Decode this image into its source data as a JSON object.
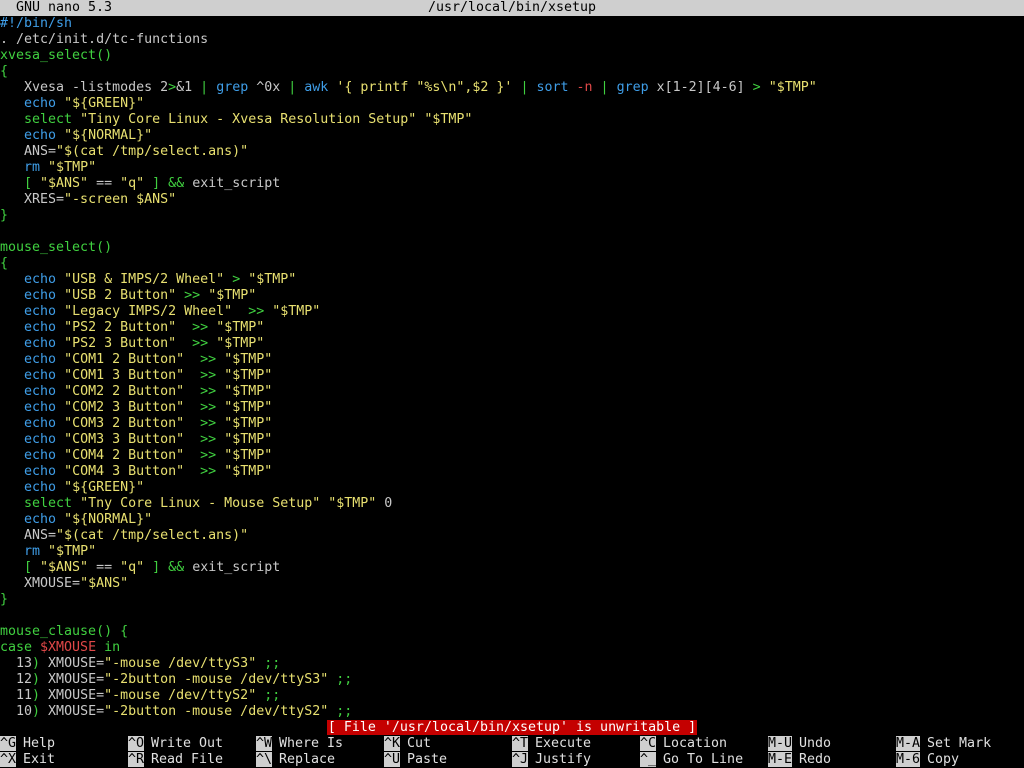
{
  "colors": {
    "default": "#c8c8c8",
    "green": "#40d040",
    "cyan": "#3f9ee8",
    "yellow": "#e8e070",
    "red": "#e04848",
    "white": "#ffffff",
    "status_bg": "#c40000",
    "bar_bg": "#cfcfcf"
  },
  "titlebar": {
    "app": "GNU nano 5.3",
    "file": "/usr/local/bin/xsetup"
  },
  "status": "[ File '/usr/local/bin/xsetup' is unwritable ]",
  "lines": [
    [
      [
        "#!/bin/sh",
        "cyan"
      ]
    ],
    [
      [
        ". /etc/init.d/tc-functions",
        "default"
      ]
    ],
    [
      [
        "xvesa_select()",
        "green"
      ]
    ],
    [
      [
        "{",
        "green"
      ]
    ],
    [
      [
        "   Xvesa -listmodes 2",
        "default"
      ],
      [
        ">",
        "green"
      ],
      [
        "&1 ",
        "default"
      ],
      [
        "|",
        "green"
      ],
      [
        " grep ",
        "cyan"
      ],
      [
        "^0x ",
        "default"
      ],
      [
        "|",
        "green"
      ],
      [
        " awk ",
        "cyan"
      ],
      [
        "'{ printf \"%s\\n\",$2 }'",
        "yellow"
      ],
      [
        " | ",
        "green"
      ],
      [
        "sort",
        "cyan"
      ],
      [
        " -n",
        "red"
      ],
      [
        " | ",
        "green"
      ],
      [
        "grep ",
        "cyan"
      ],
      [
        "x[1-2][4-6] ",
        "default"
      ],
      [
        "> ",
        "green"
      ],
      [
        "\"$TMP\"",
        "yellow"
      ]
    ],
    [
      [
        "   ",
        "default"
      ],
      [
        "echo",
        "cyan"
      ],
      [
        " \"${GREEN}\"",
        "yellow"
      ]
    ],
    [
      [
        "   ",
        "default"
      ],
      [
        "select",
        "green"
      ],
      [
        " \"Tiny Core Linux - Xvesa Resolution Setup\" \"$TMP\"",
        "yellow"
      ]
    ],
    [
      [
        "   ",
        "default"
      ],
      [
        "echo",
        "cyan"
      ],
      [
        " \"${NORMAL}\"",
        "yellow"
      ]
    ],
    [
      [
        "   ANS=",
        "default"
      ],
      [
        "\"$(cat /tmp/select.ans)\"",
        "yellow"
      ]
    ],
    [
      [
        "   ",
        "default"
      ],
      [
        "rm",
        "cyan"
      ],
      [
        " \"$TMP\"",
        "yellow"
      ]
    ],
    [
      [
        "   [ ",
        "green"
      ],
      [
        "\"$ANS\"",
        "yellow"
      ],
      [
        " == ",
        "default"
      ],
      [
        "\"q\"",
        "yellow"
      ],
      [
        " ] && ",
        "green"
      ],
      [
        "exit_script",
        "default"
      ]
    ],
    [
      [
        "   XRES=",
        "default"
      ],
      [
        "\"-screen $ANS\"",
        "yellow"
      ]
    ],
    [
      [
        "}",
        "green"
      ]
    ],
    [
      [
        "",
        "default"
      ]
    ],
    [
      [
        "mouse_select()",
        "green"
      ]
    ],
    [
      [
        "{",
        "green"
      ]
    ],
    [
      [
        "   ",
        "default"
      ],
      [
        "echo",
        "cyan"
      ],
      [
        " \"USB & IMPS/2 Wheel\"",
        "yellow"
      ],
      [
        " > ",
        "green"
      ],
      [
        "\"$TMP\"",
        "yellow"
      ]
    ],
    [
      [
        "   ",
        "default"
      ],
      [
        "echo",
        "cyan"
      ],
      [
        " \"USB 2 Button\"",
        "yellow"
      ],
      [
        " >> ",
        "green"
      ],
      [
        "\"$TMP\"",
        "yellow"
      ]
    ],
    [
      [
        "   ",
        "default"
      ],
      [
        "echo",
        "cyan"
      ],
      [
        " \"Legacy IMPS/2 Wheel\"",
        "yellow"
      ],
      [
        "  >> ",
        "green"
      ],
      [
        "\"$TMP\"",
        "yellow"
      ]
    ],
    [
      [
        "   ",
        "default"
      ],
      [
        "echo",
        "cyan"
      ],
      [
        " \"PS2 2 Button\"",
        "yellow"
      ],
      [
        "  >> ",
        "green"
      ],
      [
        "\"$TMP\"",
        "yellow"
      ]
    ],
    [
      [
        "   ",
        "default"
      ],
      [
        "echo",
        "cyan"
      ],
      [
        " \"PS2 3 Button\"",
        "yellow"
      ],
      [
        "  >> ",
        "green"
      ],
      [
        "\"$TMP\"",
        "yellow"
      ]
    ],
    [
      [
        "   ",
        "default"
      ],
      [
        "echo",
        "cyan"
      ],
      [
        " \"COM1 2 Button\"",
        "yellow"
      ],
      [
        "  >> ",
        "green"
      ],
      [
        "\"$TMP\"",
        "yellow"
      ]
    ],
    [
      [
        "   ",
        "default"
      ],
      [
        "echo",
        "cyan"
      ],
      [
        " \"COM1 3 Button\"",
        "yellow"
      ],
      [
        "  >> ",
        "green"
      ],
      [
        "\"$TMP\"",
        "yellow"
      ]
    ],
    [
      [
        "   ",
        "default"
      ],
      [
        "echo",
        "cyan"
      ],
      [
        " \"COM2 2 Button\"",
        "yellow"
      ],
      [
        "  >> ",
        "green"
      ],
      [
        "\"$TMP\"",
        "yellow"
      ]
    ],
    [
      [
        "   ",
        "default"
      ],
      [
        "echo",
        "cyan"
      ],
      [
        " \"COM2 3 Button\"",
        "yellow"
      ],
      [
        "  >> ",
        "green"
      ],
      [
        "\"$TMP\"",
        "yellow"
      ]
    ],
    [
      [
        "   ",
        "default"
      ],
      [
        "echo",
        "cyan"
      ],
      [
        " \"COM3 2 Button\"",
        "yellow"
      ],
      [
        "  >> ",
        "green"
      ],
      [
        "\"$TMP\"",
        "yellow"
      ]
    ],
    [
      [
        "   ",
        "default"
      ],
      [
        "echo",
        "cyan"
      ],
      [
        " \"COM3 3 Button\"",
        "yellow"
      ],
      [
        "  >> ",
        "green"
      ],
      [
        "\"$TMP\"",
        "yellow"
      ]
    ],
    [
      [
        "   ",
        "default"
      ],
      [
        "echo",
        "cyan"
      ],
      [
        " \"COM4 2 Button\"",
        "yellow"
      ],
      [
        "  >> ",
        "green"
      ],
      [
        "\"$TMP\"",
        "yellow"
      ]
    ],
    [
      [
        "   ",
        "default"
      ],
      [
        "echo",
        "cyan"
      ],
      [
        " \"COM4 3 Button\"",
        "yellow"
      ],
      [
        "  >> ",
        "green"
      ],
      [
        "\"$TMP\"",
        "yellow"
      ]
    ],
    [
      [
        "   ",
        "default"
      ],
      [
        "echo",
        "cyan"
      ],
      [
        " \"${GREEN}\"",
        "yellow"
      ]
    ],
    [
      [
        "   ",
        "default"
      ],
      [
        "select",
        "green"
      ],
      [
        " \"Tny Core Linux - Mouse Setup\" \"$TMP\"",
        "yellow"
      ],
      [
        " 0",
        "default"
      ]
    ],
    [
      [
        "   ",
        "default"
      ],
      [
        "echo",
        "cyan"
      ],
      [
        " \"${NORMAL}\"",
        "yellow"
      ]
    ],
    [
      [
        "   ANS=",
        "default"
      ],
      [
        "\"$(cat /tmp/select.ans)\"",
        "yellow"
      ]
    ],
    [
      [
        "   ",
        "default"
      ],
      [
        "rm",
        "cyan"
      ],
      [
        " \"$TMP\"",
        "yellow"
      ]
    ],
    [
      [
        "   [ ",
        "green"
      ],
      [
        "\"$ANS\"",
        "yellow"
      ],
      [
        " == ",
        "default"
      ],
      [
        "\"q\"",
        "yellow"
      ],
      [
        " ] && ",
        "green"
      ],
      [
        "exit_script",
        "default"
      ]
    ],
    [
      [
        "   XMOUSE=",
        "default"
      ],
      [
        "\"$ANS\"",
        "yellow"
      ]
    ],
    [
      [
        "}",
        "green"
      ]
    ],
    [
      [
        "",
        "default"
      ]
    ],
    [
      [
        "mouse_clause() {",
        "green"
      ]
    ],
    [
      [
        "case ",
        "green"
      ],
      [
        "$XMOUSE",
        "red"
      ],
      [
        " in",
        "green"
      ]
    ],
    [
      [
        "  13",
        "default"
      ],
      [
        ")",
        "green"
      ],
      [
        " XMOUSE=",
        "default"
      ],
      [
        "\"-mouse /dev/ttyS3\"",
        "yellow"
      ],
      [
        " ;;",
        "green"
      ]
    ],
    [
      [
        "  12",
        "default"
      ],
      [
        ")",
        "green"
      ],
      [
        " XMOUSE=",
        "default"
      ],
      [
        "\"-2button -mouse /dev/ttyS3\"",
        "yellow"
      ],
      [
        " ;;",
        "green"
      ]
    ],
    [
      [
        "  11",
        "default"
      ],
      [
        ")",
        "green"
      ],
      [
        " XMOUSE=",
        "default"
      ],
      [
        "\"-mouse /dev/ttyS2\"",
        "yellow"
      ],
      [
        " ;;",
        "green"
      ]
    ],
    [
      [
        "  10",
        "default"
      ],
      [
        ")",
        "green"
      ],
      [
        " XMOUSE=",
        "default"
      ],
      [
        "\"-2button -mouse /dev/ttyS2\"",
        "yellow"
      ],
      [
        " ;;",
        "green"
      ]
    ]
  ],
  "shortcuts": [
    {
      "key": "^G",
      "label": "Help",
      "name": "shortcut-help"
    },
    {
      "key": "^X",
      "label": "Exit",
      "name": "shortcut-exit"
    },
    {
      "key": "^O",
      "label": "Write Out",
      "name": "shortcut-write-out"
    },
    {
      "key": "^R",
      "label": "Read File",
      "name": "shortcut-read-file"
    },
    {
      "key": "^W",
      "label": "Where Is",
      "name": "shortcut-where-is"
    },
    {
      "key": "^\\",
      "label": "Replace",
      "name": "shortcut-replace"
    },
    {
      "key": "^K",
      "label": "Cut",
      "name": "shortcut-cut"
    },
    {
      "key": "^U",
      "label": "Paste",
      "name": "shortcut-paste"
    },
    {
      "key": "^T",
      "label": "Execute",
      "name": "shortcut-execute"
    },
    {
      "key": "^J",
      "label": "Justify",
      "name": "shortcut-justify"
    },
    {
      "key": "^C",
      "label": "Location",
      "name": "shortcut-location"
    },
    {
      "key": "^_",
      "label": "Go To Line",
      "name": "shortcut-go-to-line"
    },
    {
      "key": "M-U",
      "label": "Undo",
      "name": "shortcut-undo"
    },
    {
      "key": "M-E",
      "label": "Redo",
      "name": "shortcut-redo"
    },
    {
      "key": "M-A",
      "label": "Set Mark",
      "name": "shortcut-set-mark"
    },
    {
      "key": "M-6",
      "label": "Copy",
      "name": "shortcut-copy"
    }
  ]
}
